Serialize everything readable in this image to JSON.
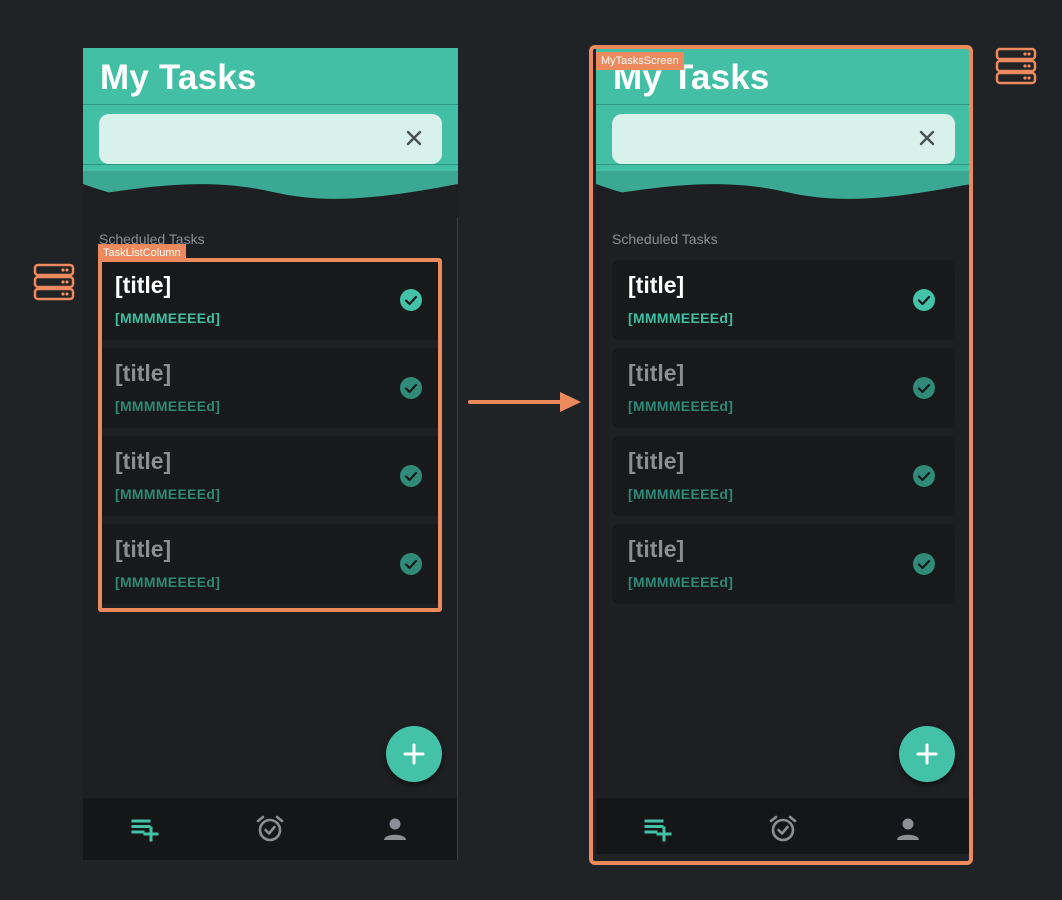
{
  "screen": {
    "title": "My Tasks",
    "search": {
      "value": ""
    },
    "section_label": "Scheduled Tasks",
    "tasks": [
      {
        "title": "[title]",
        "date": "[MMMMEEEEd]",
        "done": true
      },
      {
        "title": "[title]",
        "date": "[MMMMEEEEd]",
        "done": true
      },
      {
        "title": "[title]",
        "date": "[MMMMEEEEd]",
        "done": true
      },
      {
        "title": "[title]",
        "date": "[MMMMEEEEd]",
        "done": true
      }
    ],
    "bottom_nav": [
      {
        "icon": "playlist-add-icon",
        "active": true
      },
      {
        "icon": "alarm-check-icon",
        "active": false
      },
      {
        "icon": "person-icon",
        "active": false
      }
    ],
    "fab_icon": "plus-icon"
  },
  "annotations": {
    "column_label": "TaskListColumn",
    "screen_label": "MyTasksScreen"
  },
  "colors": {
    "accent": "#43bfa6",
    "highlight": "#ec8a5e",
    "background": "#202326",
    "surface": "#1d1f22"
  }
}
